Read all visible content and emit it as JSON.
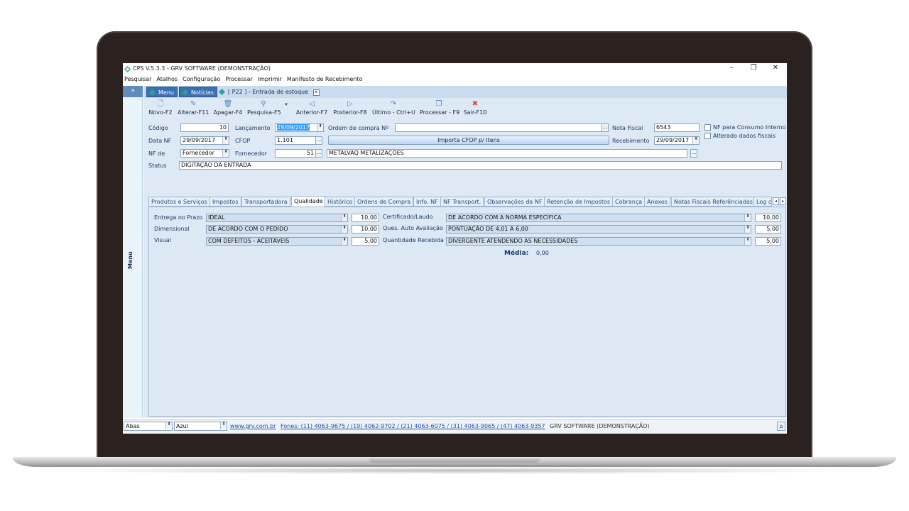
{
  "window": {
    "title": "CPS V.5.3.3 - GRV SOFTWARE (DEMONSTRAÇÃO)",
    "minimize": "–",
    "restore": "❐",
    "close": "✕"
  },
  "menubar": [
    "Pesquisar",
    "Atalhos",
    "Configuração",
    "Processar",
    "Imprimir",
    "Manifesto de Recebimento"
  ],
  "sidebar": {
    "toggle": "»",
    "label": "Menu"
  },
  "doc_tabs": {
    "menu": "Menu",
    "news": "Notícias",
    "current": "[ P22 ] - Entrada de estoque",
    "close": "✕"
  },
  "toolbar": [
    {
      "label": "Novo-F2",
      "icon": "🗋"
    },
    {
      "label": "Alterar-F11",
      "icon": "✎"
    },
    {
      "label": "Apagar-F4",
      "icon": "🗑"
    },
    {
      "label": "Pesquisa-F5",
      "icon": "⚲"
    },
    {
      "label": "Anterior-F7",
      "icon": "◁"
    },
    {
      "label": "Posterior-F8",
      "icon": "▷"
    },
    {
      "label": "Último - Ctrl+U",
      "icon": "↷"
    },
    {
      "label": "Processar - F9",
      "icon": "❐"
    },
    {
      "label": "Sair-F10",
      "icon": "✖"
    }
  ],
  "toolbar_dropdown": "▾",
  "form": {
    "codigo_label": "Código",
    "codigo": "10",
    "lancamento_label": "Lançamento",
    "lancamento": "29/09/2017",
    "ordem_label": "Ordem de compra Nº",
    "ordem": "",
    "nota_label": "Nota Fiscal",
    "nota": "6543",
    "data_nf_label": "Data NF",
    "data_nf": "29/09/2017",
    "cfop_label": "CFOP",
    "cfop": "1.101",
    "importa_button": "Importa CFOP p/ Itens",
    "recebimento_label": "Recebimento",
    "recebimento": "29/09/2017",
    "nf_de_label": "NF de",
    "nf_de": "Fornecedor",
    "fornecedor_label": "Fornecedor",
    "fornecedor_code": "51",
    "fornecedor_name": "METALVAQ METALIZAÇÕES",
    "status_label": "Status",
    "status": "DIGITAÇÃO DA ENTRADA",
    "consumo_interno": "NF para Consumo Interno",
    "alterado_fiscais": "Alterado dados fiscais",
    "dots": "…"
  },
  "form_tabs": [
    "Produtos e Serviços",
    "Impostos",
    "Transportadora",
    "Qualidade",
    "Histórico",
    "Ordens de Compra",
    "Info. NF",
    "NF Transport.",
    "Observações da NF",
    "Retenção de Impostos",
    "Cobrança",
    "Anexos",
    "Notas Fiscais Referênciadas",
    "Log c"
  ],
  "tab_arrows": {
    "left": "◂",
    "right": "▸"
  },
  "quality": {
    "rows_left": [
      {
        "label": "Entrega no Prazo",
        "value": "IDEAL",
        "score": "10,00"
      },
      {
        "label": "Dimensional",
        "value": "DE ACORDO COM O PEDIDO",
        "score": "10,00"
      },
      {
        "label": "Visual",
        "value": "COM DEFEITOS - ACEITÁVEIS",
        "score": "5,00"
      }
    ],
    "rows_right": [
      {
        "label": "Certificado/Laudo",
        "value": "DE ACORDO COM A NORMA ESPECÍFICA",
        "score": "10,00"
      },
      {
        "label": "Ques. Auto Avaliação",
        "value": "PONTUAÇÃO DE 4,01 A 6,00",
        "score": "5,00"
      },
      {
        "label": "Quantidade Recebida",
        "value": "DIVERGENTE ATENDENDO AS NECESSIDADES",
        "score": "5,00"
      }
    ],
    "media_label": "Média:",
    "media": "0,00"
  },
  "statusbar": {
    "abas": "Abas",
    "theme": "Azul",
    "site": "www.grv.com.br",
    "phones": "Fones: (11) 4063-9675 / (19) 4062-9702 / (21) 4063-6075 / (31) 4063-9065 / (47) 4063-9357",
    "company": "GRV SOFTWARE (DEMONSTRAÇÃO)",
    "home": "⌂"
  },
  "spin": "⬍"
}
